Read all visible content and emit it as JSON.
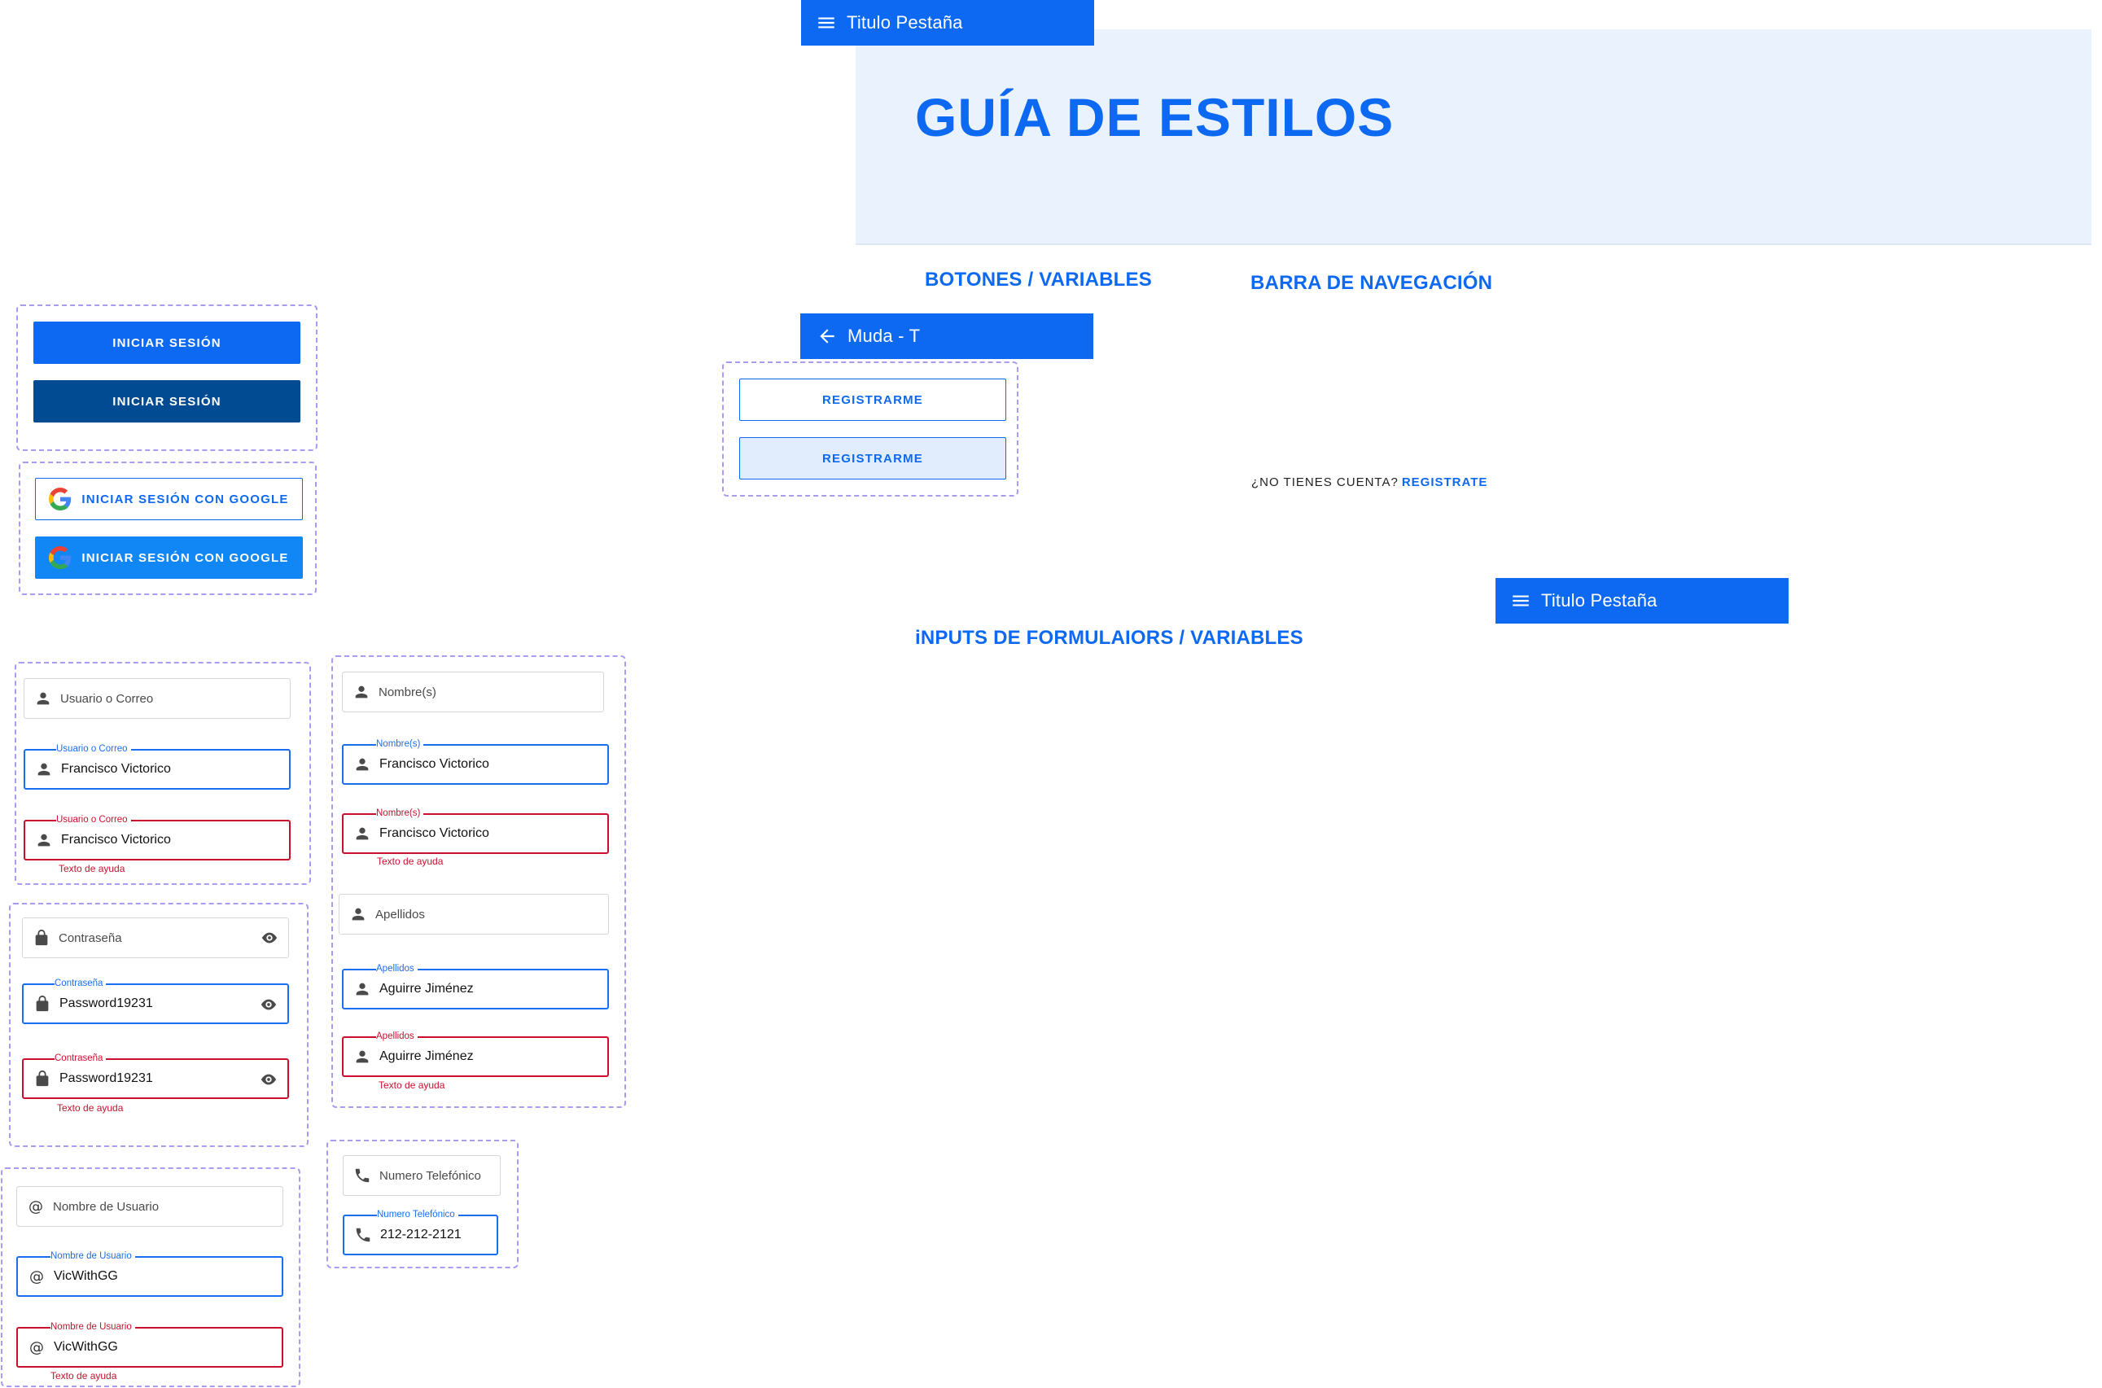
{
  "header": {
    "top_appbar_title": "Titulo Pestaña",
    "hero_title": "GUÍA DE ESTILOS"
  },
  "sections": {
    "buttons": "BOTONES / VARIABLES",
    "navbar": "BARRA DE NAVEGACIÓN",
    "inputs": "iNPUTS DE FORMULAIORS / VARIABLES"
  },
  "navbar": {
    "back_title": "Muda - T",
    "tab_title": "Titulo Pestaña"
  },
  "buttons": {
    "login_primary": "INICIAR SESIÓN",
    "login_dark": "INICIAR SESIÓN",
    "google_outline": "INICIAR SESIÓN CON GOOGLE",
    "google_fill": "INICIAR SESIÓN CON GOOGLE",
    "register_outline": "REGISTRARME",
    "register_soft": "REGISTRARME"
  },
  "signup": {
    "question": "¿NO TIENES CUENTA?",
    "link": "REGISTRATE"
  },
  "inputs": {
    "user": {
      "placeholder": "Usuario o Correo",
      "label": "Usuario o Correo",
      "value": "Francisco Victorico",
      "help": "Texto de ayuda"
    },
    "password": {
      "placeholder": "Contraseña",
      "label": "Contraseña",
      "value": "Password19231",
      "help": "Texto de ayuda"
    },
    "username": {
      "placeholder": "Nombre de Usuario",
      "label": "Nombre de Usuario",
      "value": "VicWithGG",
      "help": "Texto de ayuda"
    },
    "names": {
      "placeholder": "Nombre(s)",
      "label": "Nombre(s)",
      "value": "Francisco Victorico",
      "help": "Texto de ayuda"
    },
    "surnames": {
      "placeholder": "Apellidos",
      "label": "Apellidos",
      "value": "Aguirre Jiménez",
      "help": "Texto de ayuda"
    },
    "phone": {
      "placeholder": "Numero Telefónico",
      "label": "Numero Telefónico",
      "value": "212-212-2121"
    }
  },
  "colors": {
    "primary": "#0d69f2",
    "primary_dark": "#004b91",
    "google_blue": "#1187f5",
    "error": "#c8102e",
    "hero_bg": "#eaf2fd",
    "group_border": "#a99af2"
  }
}
